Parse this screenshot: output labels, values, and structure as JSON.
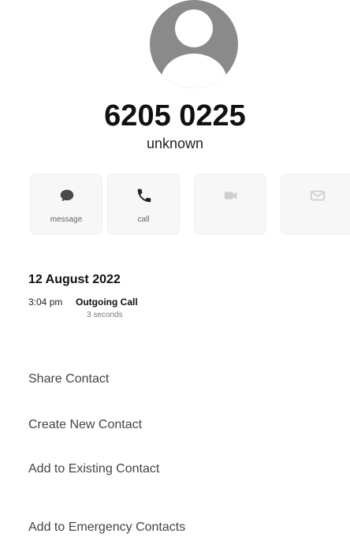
{
  "contact": {
    "number": "6205 0225",
    "label": "unknown"
  },
  "actions": [
    {
      "label": "message",
      "icon": "message-icon"
    },
    {
      "label": "call",
      "icon": "phone-icon"
    },
    {
      "label": "",
      "icon": "video-icon"
    },
    {
      "label": "",
      "icon": "mail-icon"
    }
  ],
  "call_log": {
    "date": "12 August 2022",
    "time": "3:04 pm",
    "type": "Outgoing Call",
    "duration": "3 seconds"
  },
  "menu": {
    "share": "Share Contact",
    "create": "Create New Contact",
    "add_existing": "Add to Existing Contact",
    "add_emergency": "Add to Emergency Contacts"
  },
  "colors": {
    "avatar_bg": "#8a8a8a",
    "text_primary": "#111111",
    "text_secondary": "#444444"
  }
}
